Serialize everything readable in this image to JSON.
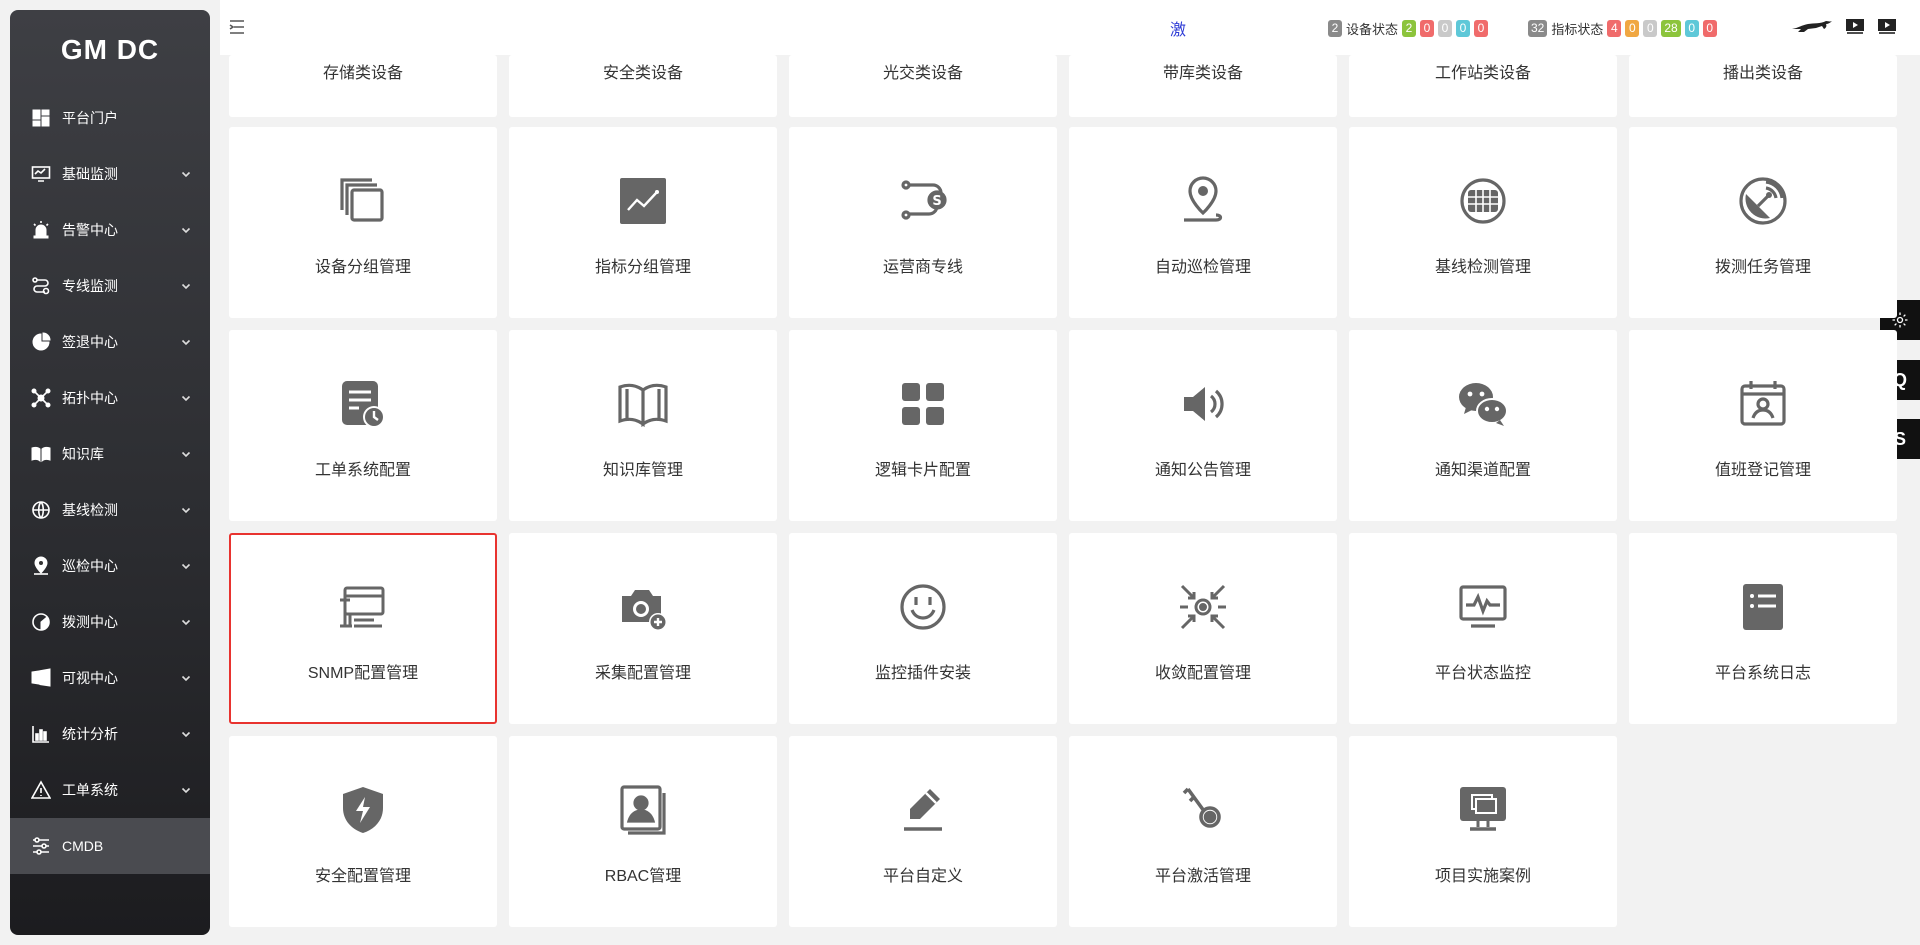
{
  "sidebar": {
    "brand": "GM DC",
    "items": [
      {
        "label": "平台门户",
        "icon": "dashboard-icon",
        "expandable": false
      },
      {
        "label": "基础监测",
        "icon": "monitor-icon",
        "expandable": true
      },
      {
        "label": "告警中心",
        "icon": "alarm-icon",
        "expandable": true
      },
      {
        "label": "专线监测",
        "icon": "route-icon",
        "expandable": true
      },
      {
        "label": "签退中心",
        "icon": "pie-icon",
        "expandable": true
      },
      {
        "label": "拓扑中心",
        "icon": "topology-icon",
        "expandable": true
      },
      {
        "label": "知识库",
        "icon": "book-icon",
        "expandable": true
      },
      {
        "label": "基线检测",
        "icon": "globe-icon",
        "expandable": true
      },
      {
        "label": "巡检中心",
        "icon": "location-icon",
        "expandable": true
      },
      {
        "label": "拨测中心",
        "icon": "radar-icon",
        "expandable": true
      },
      {
        "label": "可视中心",
        "icon": "windows-icon",
        "expandable": true
      },
      {
        "label": "统计分析",
        "icon": "chart-icon",
        "expandable": true
      },
      {
        "label": "工单系统",
        "icon": "warning-icon",
        "expandable": true
      },
      {
        "label": "CMDB",
        "icon": "sliders-icon",
        "expandable": false,
        "active": true
      }
    ]
  },
  "header": {
    "center_char": "激",
    "device_status": {
      "count": "2",
      "label": "设备状态",
      "values": [
        "2",
        "0",
        "0",
        "0",
        "0"
      ]
    },
    "metric_status": {
      "count": "32",
      "label": "指标状态",
      "values": [
        "4",
        "0",
        "0",
        "28",
        "0",
        "0"
      ]
    },
    "icons": [
      "logo-icon",
      "play-icon",
      "play-icon"
    ]
  },
  "float_buttons": {
    "settings": "gear-icon",
    "q": "Q",
    "s": "S"
  },
  "colors": {
    "selected_border": "#e8332f",
    "icon_gray": "#666666",
    "sidebar_bg": "#2c2d31"
  },
  "cards": [
    {
      "label": "存储类设备",
      "icon": "",
      "partial": true
    },
    {
      "label": "安全类设备",
      "icon": "",
      "partial": true
    },
    {
      "label": "光交类设备",
      "icon": "",
      "partial": true
    },
    {
      "label": "带库类设备",
      "icon": "",
      "partial": true
    },
    {
      "label": "工作站类设备",
      "icon": "",
      "partial": true
    },
    {
      "label": "播出类设备",
      "icon": "",
      "partial": true
    },
    {
      "label": "设备分组管理",
      "icon": "copy-icon"
    },
    {
      "label": "指标分组管理",
      "icon": "trend-chart-icon"
    },
    {
      "label": "运营商专线",
      "icon": "route-dollar-icon"
    },
    {
      "label": "自动巡检管理",
      "icon": "map-pin-icon"
    },
    {
      "label": "基线检测管理",
      "icon": "globe-grid-icon"
    },
    {
      "label": "拨测任务管理",
      "icon": "satellite-dish-icon"
    },
    {
      "label": "工单系统配置",
      "icon": "doc-clock-icon"
    },
    {
      "label": "知识库管理",
      "icon": "open-book-icon"
    },
    {
      "label": "逻辑卡片配置",
      "icon": "grid-icon"
    },
    {
      "label": "通知公告管理",
      "icon": "speaker-icon"
    },
    {
      "label": "通知渠道配置",
      "icon": "wechat-icon"
    },
    {
      "label": "值班登记管理",
      "icon": "calendar-user-icon"
    },
    {
      "label": "SNMP配置管理",
      "icon": "network-table-icon",
      "selected": true
    },
    {
      "label": "采集配置管理",
      "icon": "camera-plus-icon"
    },
    {
      "label": "监控插件安装",
      "icon": "plug-icon"
    },
    {
      "label": "收敛配置管理",
      "icon": "converge-icon"
    },
    {
      "label": "平台状态监控",
      "icon": "pulse-monitor-icon"
    },
    {
      "label": "平台系统日志",
      "icon": "list-doc-icon"
    },
    {
      "label": "安全配置管理",
      "icon": "shield-bolt-icon"
    },
    {
      "label": "RBAC管理",
      "icon": "user-card-icon"
    },
    {
      "label": "平台自定义",
      "icon": "pen-icon"
    },
    {
      "label": "平台激活管理",
      "icon": "key-icon"
    },
    {
      "label": "项目实施案例",
      "icon": "monitor-stack-icon"
    }
  ]
}
